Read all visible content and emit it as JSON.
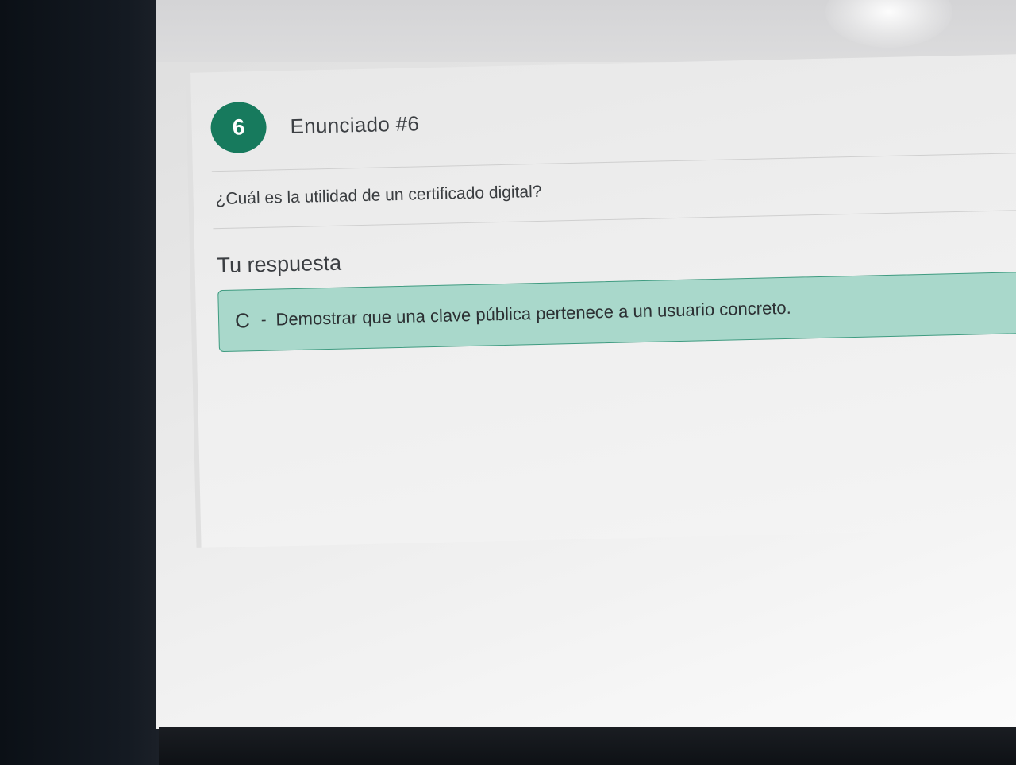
{
  "question_card": {
    "number": "6",
    "title": "Enunciado #6",
    "question": "¿Cuál es la utilidad de un certificado digital?",
    "answer_label": "Tu respuesta",
    "answer": {
      "letter": "C",
      "separator": "-",
      "text": "Demostrar que una clave pública pertenece a un usuario concreto."
    }
  },
  "colors": {
    "accent": "#177a5d",
    "answer_background": "#a9d8cb",
    "answer_border": "#3f9b80"
  }
}
